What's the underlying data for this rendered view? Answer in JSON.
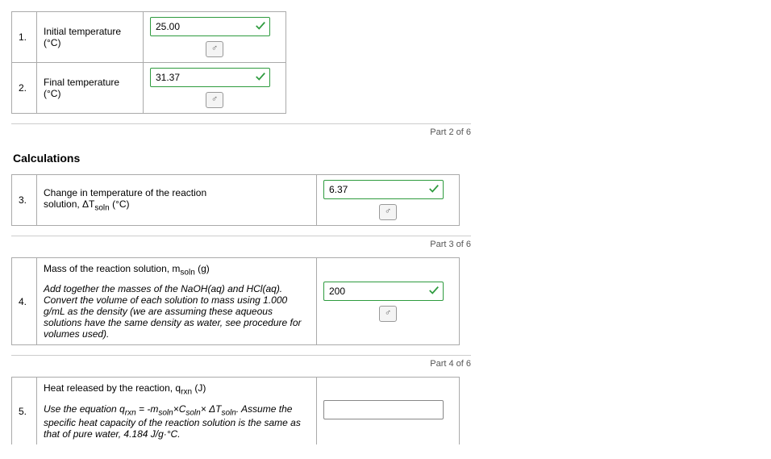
{
  "rows": {
    "r1": {
      "idx": "1.",
      "label_a": "Initial temperature",
      "label_b": "(°C)",
      "value": "25.00"
    },
    "r2": {
      "idx": "2.",
      "label": "Final temperature (°C)",
      "value": "31.37"
    },
    "r3": {
      "idx": "3.",
      "label_a": "Change in temperature of the reaction",
      "label_b": "solution, ΔT",
      "label_c": " (°C)",
      "value": "6.37"
    },
    "r4": {
      "idx": "4.",
      "title_a": "Mass of the reaction solution, m",
      "title_b": " (g)",
      "hint": "Add together the masses of the NaOH(aq) and HCl(aq). Convert the volume of each solution to mass using 1.000 g/mL as the density (we are assuming these aqueous solutions have the same density as water, see procedure for volumes used).",
      "value": "200"
    },
    "r5": {
      "idx": "5.",
      "title_a": "Heat released by the reaction, q",
      "title_b": " (J)",
      "hint_a": "Use the equation q",
      "hint_b": " = -m",
      "hint_c": "×C",
      "hint_d": "× ΔT",
      "hint_e": ". Assume the specific heat capacity of the reaction solution is the same as that of pure water, 4.184 J/g·°C.",
      "value": ""
    }
  },
  "sub": {
    "soln": "soln",
    "rxn": "rxn"
  },
  "sections": {
    "calc_heading": "Calculations",
    "p2": "Part 2 of 6",
    "p3": "Part 3 of 6",
    "p4": "Part 4 of 6"
  },
  "icon": {
    "deg": "♂"
  }
}
